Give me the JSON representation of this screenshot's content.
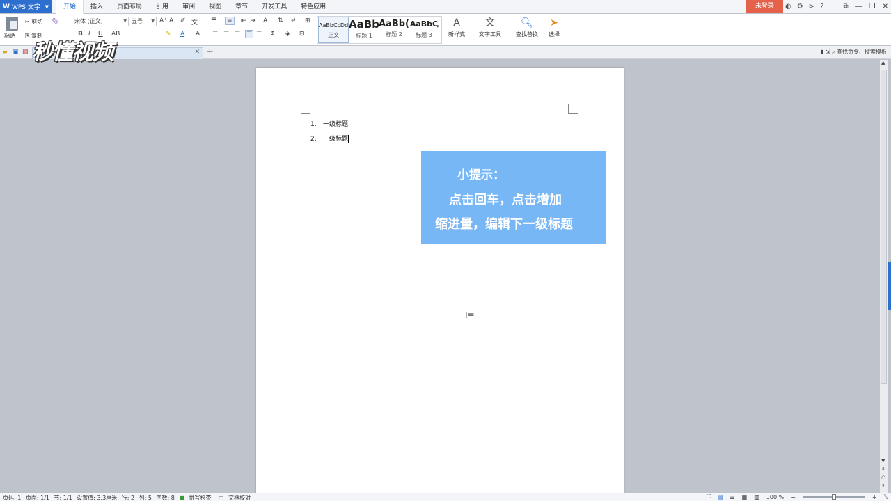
{
  "app": {
    "name": "WPS 文字",
    "logo": "W"
  },
  "menu": {
    "tabs": [
      "开始",
      "插入",
      "页面布局",
      "引用",
      "审阅",
      "视图",
      "章节",
      "开发工具",
      "特色应用"
    ]
  },
  "account": {
    "login_label": "未登录"
  },
  "ribbon": {
    "paste": "粘贴",
    "cut": "剪切",
    "copy": "复制",
    "font_name": "宋体 (正文)",
    "font_size": "五号",
    "styles": [
      {
        "sample": "AaBbCcDd",
        "name": "正文"
      },
      {
        "sample": "AaBb",
        "name": "标题 1"
      },
      {
        "sample": "AaBb(",
        "name": "标题 2"
      },
      {
        "sample": "AaBbC",
        "name": "标题 3"
      }
    ],
    "new_style": "新样式",
    "text_tools": "文字工具",
    "find_replace": "查找替换",
    "select": "选择"
  },
  "docbar": {
    "search_commands": "查找命令、搜索模板"
  },
  "watermark": {
    "text": "秒懂视频"
  },
  "document": {
    "list": [
      {
        "num": "1.",
        "text": "一级标题"
      },
      {
        "num": "2.",
        "text": "一级标题"
      }
    ]
  },
  "tip": {
    "title": "小提示：",
    "line1": "点击回车，点击增加",
    "line2": "缩进量，编辑下一级标题"
  },
  "status": {
    "page_num": "页码: 1",
    "pages": "页面: 1/1",
    "section": "节: 1/1",
    "setting": "设置值: 3.3厘米",
    "row": "行: 2",
    "col": "列: 5",
    "words": "字数: 8",
    "spell_check": "拼写检查",
    "doc_check": "文档校对",
    "zoom": "100 %"
  },
  "colors": {
    "accent": "#2d6fcf",
    "tip_bg": "#78b7f6",
    "login_bg": "#e5624a"
  }
}
